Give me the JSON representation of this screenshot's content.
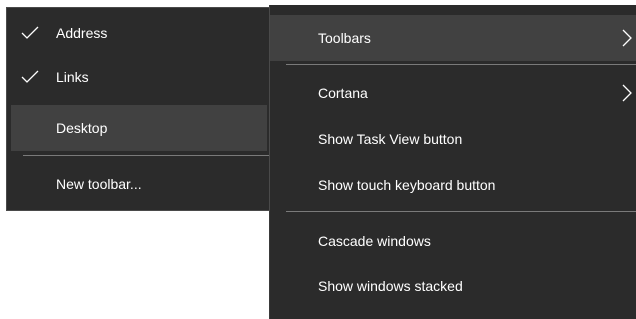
{
  "submenu": {
    "items": [
      {
        "label": "Address",
        "checked": true,
        "check_icon": "checkmark-icon"
      },
      {
        "label": "Links",
        "checked": true,
        "check_icon": "checkmark-icon"
      },
      {
        "label": "Desktop",
        "checked": false,
        "highlighted": true
      },
      {
        "label": "New toolbar...",
        "checked": false
      }
    ]
  },
  "context_menu": {
    "items": [
      {
        "label": "Toolbars",
        "has_submenu": true,
        "highlighted": true,
        "icon": "chevron-right-icon"
      },
      {
        "label": "Cortana",
        "has_submenu": true,
        "icon": "chevron-right-icon"
      },
      {
        "label": "Show Task View button"
      },
      {
        "label": "Show touch keyboard button"
      },
      {
        "label": "Cascade windows"
      },
      {
        "label": "Show windows stacked"
      }
    ]
  },
  "colors": {
    "menu_background": "#2b2b2b",
    "highlight_background": "#414141",
    "separator": "#7a7a7a",
    "text": "#ffffff",
    "page_background": "#ffffff"
  }
}
